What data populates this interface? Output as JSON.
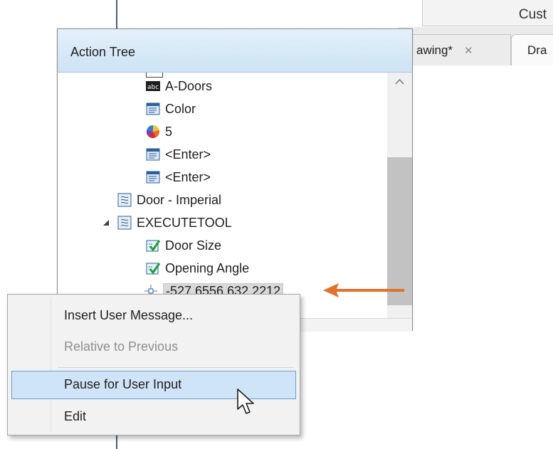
{
  "background": {
    "customize_label": "Cust",
    "tabs": [
      {
        "label": "awing*",
        "close": "✕"
      },
      {
        "label": "Dra"
      }
    ]
  },
  "palette": {
    "title": "Action Tree",
    "tree_items": [
      {
        "label": "A-Doors",
        "icon": "text-abc-icon"
      },
      {
        "label": "Color",
        "icon": "command-list-icon"
      },
      {
        "label": "5",
        "icon": "color-wheel-icon"
      },
      {
        "label": "<Enter>",
        "icon": "command-list-icon"
      },
      {
        "label": "<Enter>",
        "icon": "command-list-icon"
      },
      {
        "label": "Door - Imperial",
        "icon": "macro-node-icon"
      },
      {
        "label": "EXECUTETOOL",
        "icon": "macro-node-icon",
        "expanded": true
      },
      {
        "label": "Door Size",
        "icon": "user-input-check-icon"
      },
      {
        "label": "Opening Angle",
        "icon": "user-input-check-icon"
      },
      {
        "label": "-527.6556,632.2212",
        "icon": "coordinate-point-icon",
        "selected": true
      }
    ]
  },
  "context_menu": {
    "items": [
      {
        "label": "Insert User Message...",
        "enabled": true
      },
      {
        "label": "Relative to Previous",
        "enabled": false
      },
      {
        "label": "Pause for User Input",
        "enabled": true,
        "highlighted": true
      },
      {
        "label": "Edit",
        "enabled": true
      }
    ]
  },
  "colors": {
    "annotation_arrow": "#e2712b",
    "header_gradient_top": "#e4f0fa",
    "menu_highlight": "#cfe4f6"
  }
}
